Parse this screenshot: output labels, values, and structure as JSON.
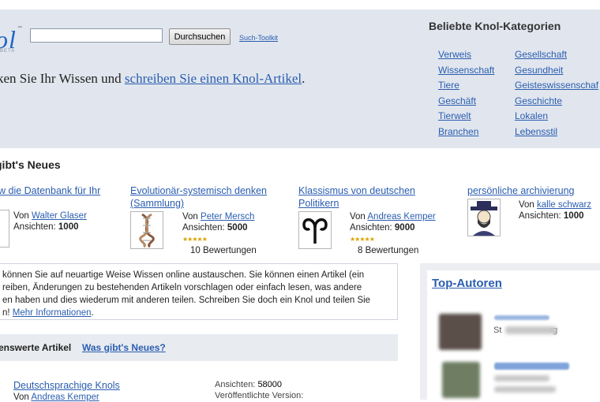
{
  "header": {
    "logo_text": "ol",
    "logo_tm": "™",
    "logo_beta": "BETA",
    "search": {
      "value": "",
      "placeholder": ""
    },
    "search_button": "Durchsuchen",
    "toolkit_link": "Such-Toolkit",
    "tagline_prefix": "ken Sie Ihr Wissen und ",
    "tagline_link": "schreiben Sie einen Knol-Artikel",
    "tagline_suffix": "."
  },
  "categories": {
    "title": "Beliebte Knol-Kategorien",
    "left": [
      "Verweis",
      "Wissenschaft",
      "Tiere",
      "Geschäft",
      "Tierwelt",
      "Branchen"
    ],
    "right": [
      "Gesellschaft",
      "Gesundheit",
      "Geisteswissenschaf",
      "Geschichte",
      "Lokalen",
      "Lebensstil"
    ]
  },
  "news": {
    "title": "gibt's Neues",
    "cards": [
      {
        "title": "w die Datenbank für Ihr",
        "by_prefix": "Von ",
        "author": "Walter Glaser",
        "views_label": "Ansichten:",
        "views": "1000",
        "ratings": ""
      },
      {
        "title": "Evolutionär-systemisch denken (Sammlung)",
        "by_prefix": "Von ",
        "author": "Peter Mersch",
        "views_label": "Ansichten:",
        "views": "5000",
        "ratings": "10 Bewertungen"
      },
      {
        "title": "Klassismus von deutschen Politikern",
        "by_prefix": "Von ",
        "author": "Andreas Kemper",
        "views_label": "Ansichten:",
        "views": "9000",
        "ratings": "8 Bewertungen"
      },
      {
        "title": "persönliche archivierung",
        "by_prefix": "Von ",
        "author": "kalle schwarz",
        "views_label": "Ansichten:",
        "views": "1000",
        "ratings": ""
      }
    ]
  },
  "description": {
    "lines": [
      "können Sie auf neuartige Weise Wissen online austauschen. Sie können einen Artikel (ein",
      "reiben, Änderungen zu bestehenden Artikeln vorschlagen oder einfach lesen, was andere",
      "en haben und dies wiederum mit anderen teilen. Schreiben Sie doch ein Knol und teilen Sie"
    ],
    "last_prefix": "n! ",
    "more_link": "Mehr Informationen",
    "last_suffix": "."
  },
  "tabs": {
    "active": "enswerte Artikel",
    "other": "Was gibt's Neues?"
  },
  "article": {
    "title": "Deutschsprachige Knols",
    "by_prefix": "Von ",
    "author": "Andreas Kemper",
    "views_label": "Ansichten:",
    "views": "58000",
    "version_label": "Veröffentlichte Version:"
  },
  "top_authors": {
    "title": "Top-Autoren",
    "authors": [
      {
        "name_blurred": "",
        "location_partial": "St                    rg"
      },
      {
        "name_blurred": "",
        "location_partial": ""
      }
    ]
  }
}
